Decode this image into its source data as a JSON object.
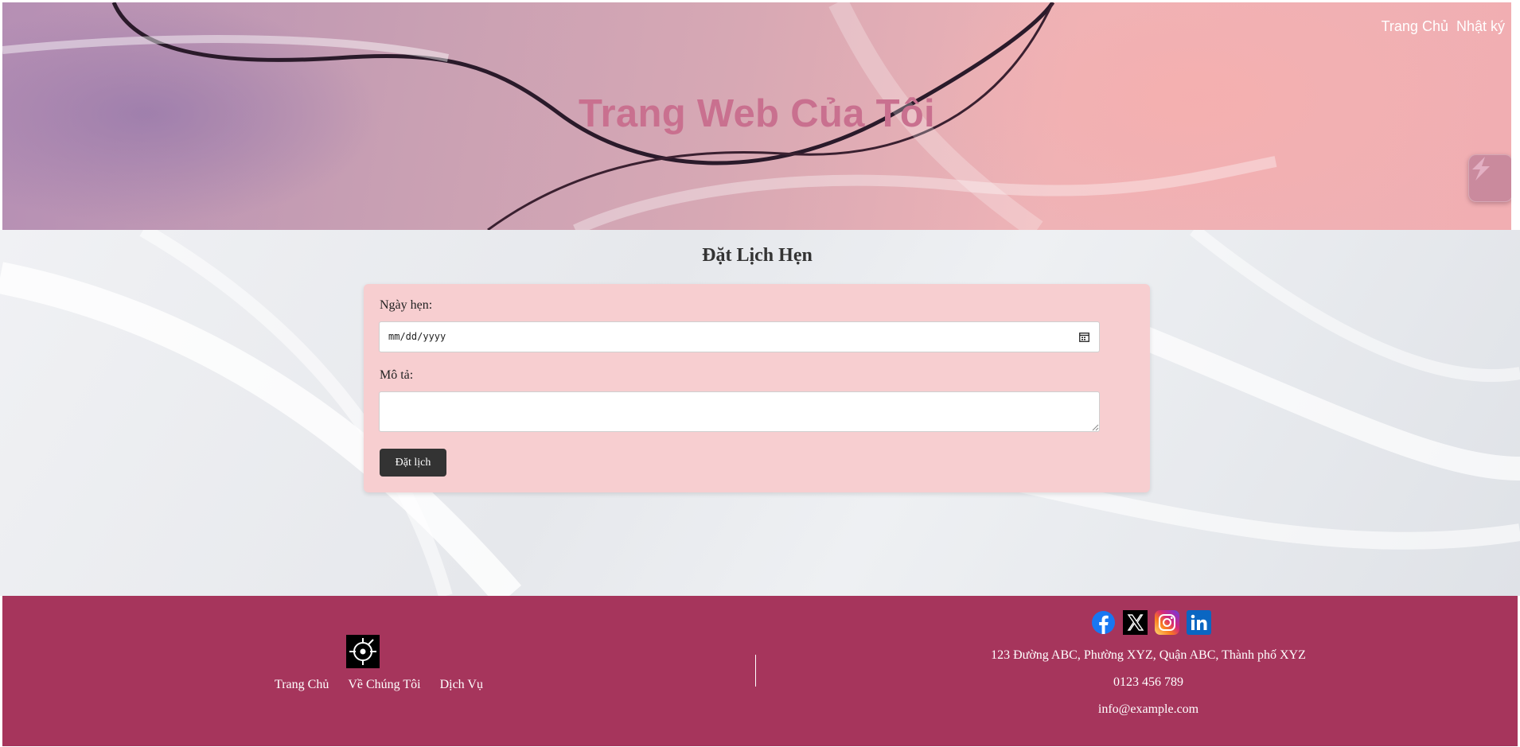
{
  "header": {
    "nav": [
      "Trang Chủ",
      "Nhật ký"
    ],
    "title": "Trang Web Của Tôi"
  },
  "form": {
    "heading": "Đặt Lịch Hẹn",
    "date_label": "Ngày hẹn:",
    "date_placeholder": "mm/dd/yyyy",
    "description_label": "Mô tả:",
    "description_value": "",
    "submit_label": "Đặt lịch"
  },
  "footer": {
    "nav": [
      "Trang Chủ",
      "Về Chúng Tôi",
      "Dịch Vụ"
    ],
    "social": [
      "facebook-icon",
      "x-twitter-icon",
      "instagram-icon",
      "linkedin-icon"
    ],
    "address": "123 Đường ABC, Phường XYZ, Quận ABC, Thành phố XYZ",
    "phone": "0123 456 789",
    "email": "info@example.com"
  },
  "colors": {
    "footer_bg": "#a6355c",
    "card_bg": "#f7ced0",
    "title": "#c9708f",
    "button_bg": "#333333"
  }
}
